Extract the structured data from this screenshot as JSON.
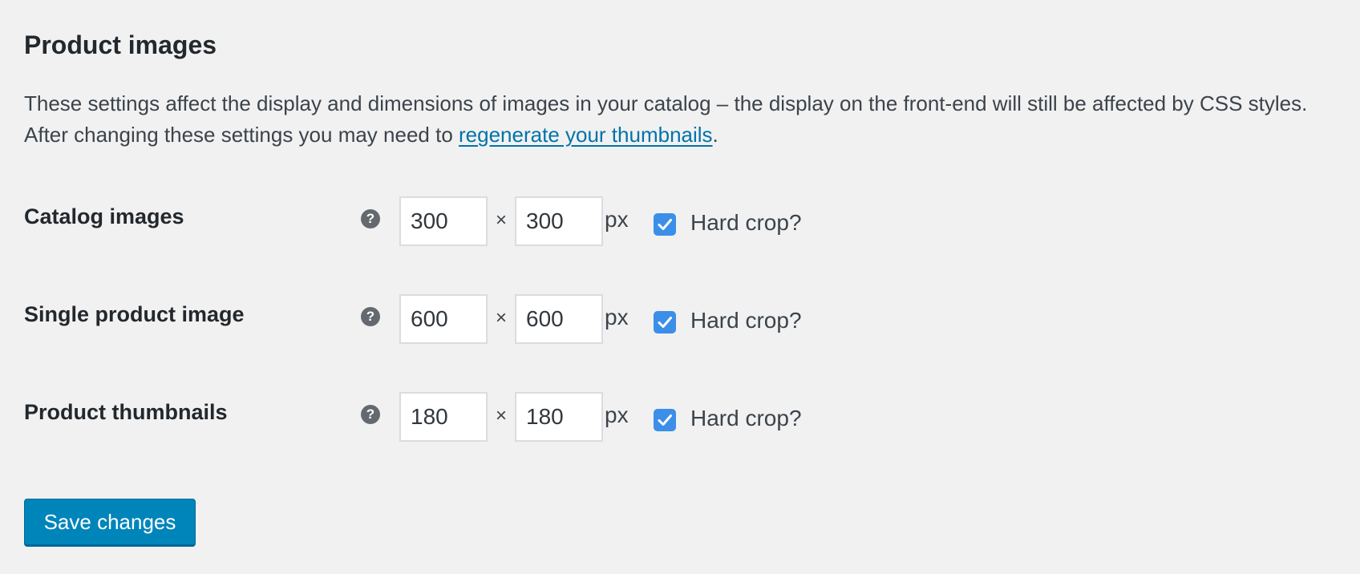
{
  "section": {
    "title": "Product images",
    "description_before_link": "These settings affect the display and dimensions of images in your catalog – the display on the front-end will still be affected by CSS styles. After changing these settings you may need to ",
    "link_text": "regenerate your thumbnails",
    "description_after_link": "."
  },
  "rows": [
    {
      "label": "Catalog images",
      "help_glyph": "?",
      "width": "300",
      "height": "300",
      "times": "×",
      "unit": "px",
      "hard_crop_checked": true,
      "hard_crop_label": "Hard crop?"
    },
    {
      "label": "Single product image",
      "help_glyph": "?",
      "width": "600",
      "height": "600",
      "times": "×",
      "unit": "px",
      "hard_crop_checked": true,
      "hard_crop_label": "Hard crop?"
    },
    {
      "label": "Product thumbnails",
      "help_glyph": "?",
      "width": "180",
      "height": "180",
      "times": "×",
      "unit": "px",
      "hard_crop_checked": true,
      "hard_crop_label": "Hard crop?"
    }
  ],
  "footer": {
    "save_label": "Save changes"
  },
  "colors": {
    "background": "#f1f1f1",
    "link": "#0073aa",
    "checkbox": "#3b8fe8",
    "primary_button": "#0085ba"
  },
  "icons": {
    "help": "help-icon",
    "check": "checkmark-icon"
  }
}
